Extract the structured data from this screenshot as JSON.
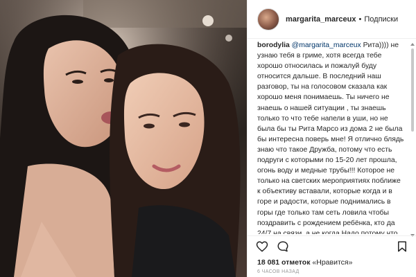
{
  "post": {
    "username": "margarita_marceux",
    "separator": "•",
    "follow_state": "Подписки"
  },
  "comment": {
    "author": "borodylia",
    "mention": "@margarita_marceux",
    "text": "Рита)))) не узнаю тебя в гриме, хотя всегда тебе хорошо относилась и пожалуй буду относится дальше. В последний наш разговор, ты на голосовом сказала как хорошо меня понимаешь. Ты ничего не знаешь о нашей ситуации , ты знаешь только то что тебе напели в уши, но не была бы ты Рита Марсо из дома 2 не была бы интересна поверь мне! Я отлично блядь знаю что такое Дружба, потому что есть подруги с которыми по 15-20 лет прошла, огонь воду и медные трубы!!! Которое не только на светских мероприятиях поближе к объективу вставали, которые когда и в горе и радости, которые поднимались в горы где только там сеть ловила чтобы поздравить с рождением ребёнка, кто да 24/7 на связи, а не когда Надо потому что очередной кипишь в Жизни! Вам я смотрю всем не даёт покоя поачка. так"
  },
  "actions": {
    "like_icon": "heart-icon",
    "comment_icon": "speech-bubble-icon",
    "save_icon": "bookmark-icon"
  },
  "likes": {
    "count": "18 081 отметок",
    "separator": "«",
    "reaction": "Нравится»"
  },
  "timestamp": "6 ЧАСОВ НАЗАД",
  "colors": {
    "text": "#262626",
    "mention": "#003569",
    "muted": "#999999",
    "border": "#efefef"
  }
}
